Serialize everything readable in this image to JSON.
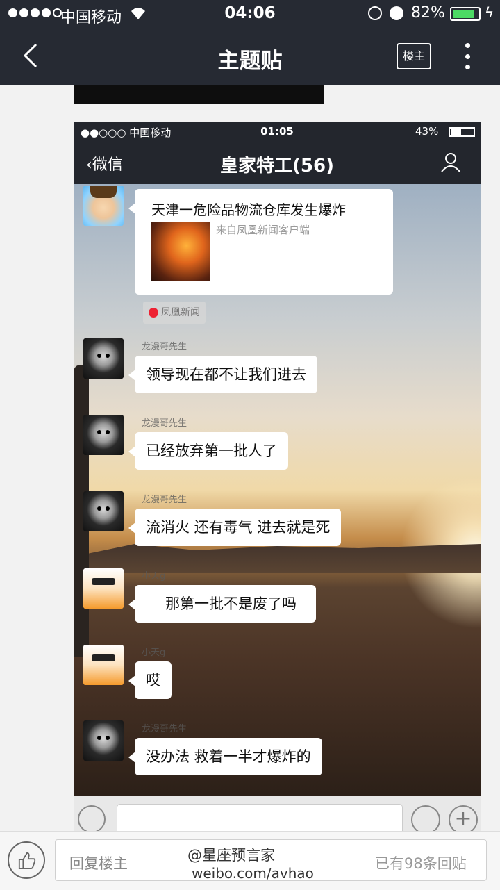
{
  "status_bar": {
    "carrier": "中国移动",
    "time": "04:06",
    "battery": "82%"
  },
  "nav": {
    "title": "主题贴",
    "louzhu": "楼主"
  },
  "screenshot": {
    "status_bar": {
      "carrier": "●●○○○ 中国移动",
      "time": "01:05",
      "battery": "43%"
    },
    "header": {
      "back": "微信",
      "group_title": "皇家特工(56)"
    },
    "card": {
      "title": "天津一危险品物流仓库发生爆炸",
      "source": "来自凤凰新闻客户端",
      "source_tag": "凤凰新闻"
    },
    "messages": [
      {
        "sender": "龙漫哥先生",
        "text": "领导现在都不让我们进去"
      },
      {
        "sender": "龙漫哥先生",
        "text": "已经放弃第一批人了"
      },
      {
        "sender": "龙漫哥先生",
        "text": "流消火 还有毒气 进去就是死"
      },
      {
        "sender": "小天g",
        "text": "那第一批不是废了吗"
      },
      {
        "sender": "小天g",
        "text": "哎"
      },
      {
        "sender": "龙漫哥先生",
        "text": "没办法 救着一半才爆炸的"
      }
    ]
  },
  "reply_bar": {
    "placeholder": "回复楼主",
    "reply_count": "已有98条回贴",
    "watermark_line1": "@星座预言家",
    "watermark_line2": "weibo.com/avhao"
  },
  "icons": [
    "signal-dots-icon",
    "wifi-icon",
    "rotation-lock-icon",
    "alarm-icon",
    "battery-icon",
    "back-chevron-icon",
    "more-icon",
    "contacts-icon",
    "voice-icon",
    "emoji-icon",
    "plus-icon",
    "thumbs-up-icon"
  ],
  "colors": {
    "nav_bg": "#262a33",
    "battery_green": "#4cd964",
    "bubble": "#ffffff"
  }
}
